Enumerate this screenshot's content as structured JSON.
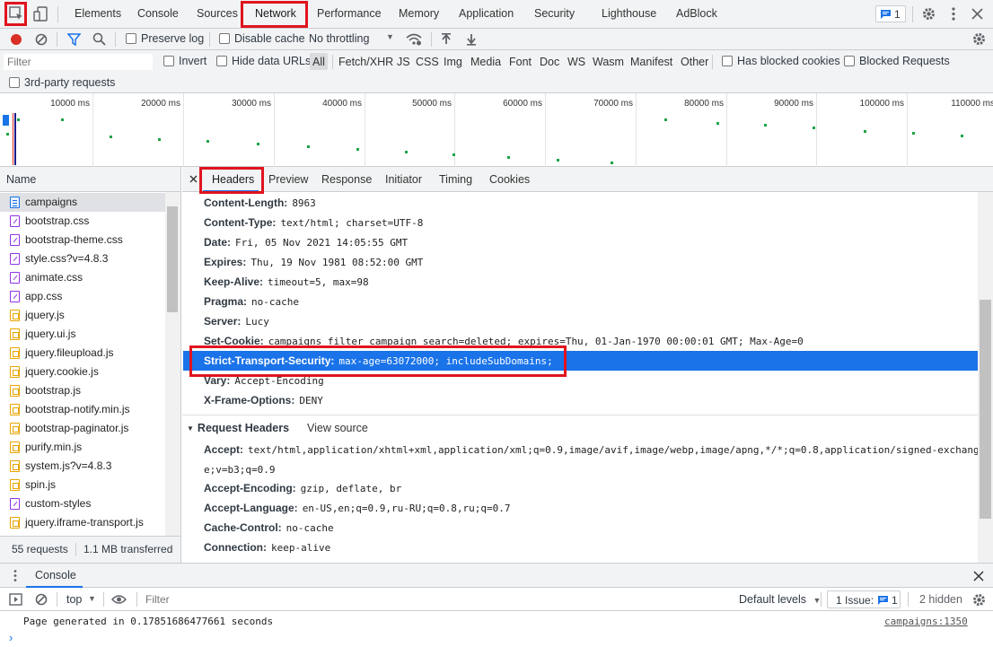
{
  "top_tabs": {
    "elements": "Elements",
    "console": "Console",
    "sources": "Sources",
    "network": "Network",
    "performance": "Performance",
    "memory": "Memory",
    "application": "Application",
    "security": "Security",
    "lighthouse": "Lighthouse",
    "adblock": "AdBlock",
    "issues_count": "1"
  },
  "toolbar": {
    "preserve_log": "Preserve log",
    "disable_cache": "Disable cache",
    "throttling": "No throttling"
  },
  "filterbar": {
    "filter_placeholder": "Filter",
    "invert": "Invert",
    "hide_data_urls": "Hide data URLs",
    "types": [
      "All",
      "Fetch/XHR",
      "JS",
      "CSS",
      "Img",
      "Media",
      "Font",
      "Doc",
      "WS",
      "Wasm",
      "Manifest",
      "Other"
    ],
    "has_blocked_cookies": "Has blocked cookies",
    "blocked_requests": "Blocked Requests",
    "third_party": "3rd-party requests"
  },
  "overview": {
    "ticks": [
      "10000 ms",
      "20000 ms",
      "30000 ms",
      "40000 ms",
      "50000 ms",
      "60000 ms",
      "70000 ms",
      "80000 ms",
      "90000 ms",
      "100000 ms",
      "110000 ms"
    ]
  },
  "requests": {
    "header": "Name",
    "items": [
      {
        "name": "campaigns",
        "type": "doc"
      },
      {
        "name": "bootstrap.css",
        "type": "css"
      },
      {
        "name": "bootstrap-theme.css",
        "type": "css"
      },
      {
        "name": "style.css?v=4.8.3",
        "type": "css"
      },
      {
        "name": "animate.css",
        "type": "css"
      },
      {
        "name": "app.css",
        "type": "css"
      },
      {
        "name": "jquery.js",
        "type": "js"
      },
      {
        "name": "jquery.ui.js",
        "type": "js"
      },
      {
        "name": "jquery.fileupload.js",
        "type": "js"
      },
      {
        "name": "jquery.cookie.js",
        "type": "js"
      },
      {
        "name": "bootstrap.js",
        "type": "js"
      },
      {
        "name": "bootstrap-notify.min.js",
        "type": "js"
      },
      {
        "name": "bootstrap-paginator.js",
        "type": "js"
      },
      {
        "name": "purify.min.js",
        "type": "js"
      },
      {
        "name": "system.js?v=4.8.3",
        "type": "js"
      },
      {
        "name": "spin.js",
        "type": "js"
      },
      {
        "name": "custom-styles",
        "type": "css"
      },
      {
        "name": "jquery.iframe-transport.js",
        "type": "js"
      }
    ],
    "summary_requests": "55 requests",
    "summary_transferred": "1.1 MB transferred"
  },
  "detail_tabs": {
    "headers": "Headers",
    "preview": "Preview",
    "response": "Response",
    "initiator": "Initiator",
    "timing": "Timing",
    "cookies": "Cookies"
  },
  "response_headers": [
    {
      "name": "Content-Length:",
      "value": "8963"
    },
    {
      "name": "Content-Type:",
      "value": "text/html; charset=UTF-8"
    },
    {
      "name": "Date:",
      "value": "Fri, 05 Nov 2021 14:05:55 GMT"
    },
    {
      "name": "Expires:",
      "value": "Thu, 19 Nov 1981 08:52:00 GMT"
    },
    {
      "name": "Keep-Alive:",
      "value": "timeout=5, max=98"
    },
    {
      "name": "Pragma:",
      "value": "no-cache"
    },
    {
      "name": "Server:",
      "value": "Lucy"
    },
    {
      "name": "Set-Cookie:",
      "value": "campaigns_filter_campaign_search=deleted; expires=Thu, 01-Jan-1970 00:00:01 GMT; Max-Age=0"
    },
    {
      "name": "Strict-Transport-Security:",
      "value": "max-age=63072000; includeSubDomains;"
    },
    {
      "name": "Vary:",
      "value": "Accept-Encoding"
    },
    {
      "name": "X-Frame-Options:",
      "value": "DENY"
    }
  ],
  "request_headers": {
    "title": "Request Headers",
    "view_source": "View source",
    "items": [
      {
        "name": "Accept:",
        "value": "text/html,application/xhtml+xml,application/xml;q=0.9,image/avif,image/webp,image/apng,*/*;q=0.8,application/signed-exchang",
        "cont": "e;v=b3;q=0.9"
      },
      {
        "name": "Accept-Encoding:",
        "value": "gzip, deflate, br"
      },
      {
        "name": "Accept-Language:",
        "value": "en-US,en;q=0.9,ru-RU;q=0.8,ru;q=0.7"
      },
      {
        "name": "Cache-Control:",
        "value": "no-cache"
      },
      {
        "name": "Connection:",
        "value": "keep-alive"
      }
    ]
  },
  "drawer": {
    "console_tab": "Console",
    "context": "top",
    "filter_placeholder": "Filter",
    "default_levels": "Default levels",
    "issues_label": "1 Issue:",
    "issues_count": "1",
    "hidden": "2 hidden",
    "message": "Page generated in 0.17851686477661 seconds",
    "source_link": "campaigns:1350",
    "prompt": "›"
  },
  "colors": {
    "accent": "#1a73e8",
    "highlight_box": "#e0141e",
    "record": "#d93025"
  }
}
